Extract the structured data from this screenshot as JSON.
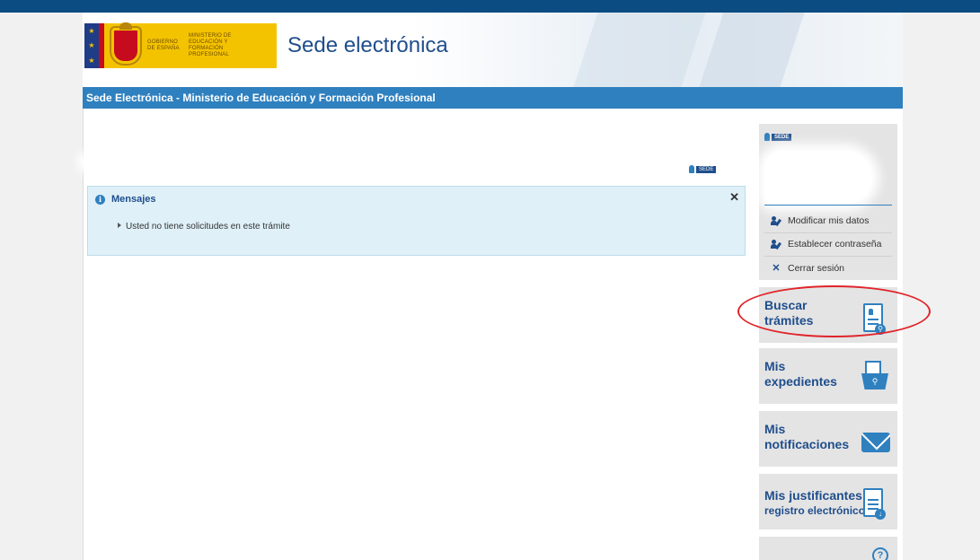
{
  "header": {
    "logo_gov": "GOBIERNO DE ESPAÑA",
    "logo_ministry": "MINISTERIO DE EDUCACIÓN Y FORMACIÓN PROFESIONAL",
    "site_title": "Sede electrónica"
  },
  "navbar": {
    "title": "Sede Electrónica - Ministerio de Educación y Formación Profesional"
  },
  "user_badge_label": "SEDE",
  "messages": {
    "title": "Mensajes",
    "close_symbol": "✕",
    "items": [
      "Usted no tiene solicitudes en este trámite"
    ]
  },
  "sidebar": {
    "user_links": [
      {
        "label": "Modificar mis datos",
        "icon": "user-edit-icon"
      },
      {
        "label": "Establecer contraseña",
        "icon": "user-key-icon"
      },
      {
        "label": "Cerrar sesión",
        "icon": "close-icon"
      }
    ],
    "tiles": [
      {
        "line1": "Buscar",
        "line2": "trámites",
        "icon": "document-search-icon"
      },
      {
        "line1": "Mis",
        "line2": "expedientes",
        "icon": "folder-search-icon"
      },
      {
        "line1": "Mis",
        "line2": "notificaciones",
        "icon": "envelope-icon"
      },
      {
        "line1": "Mis justificantes",
        "line2": "registro electrónico",
        "icon": "document-download-icon"
      }
    ]
  },
  "colors": {
    "topbar": "#0b4c82",
    "navbar": "#2f80bf",
    "brand_text": "#1f4e8c",
    "messages_bg": "#dff0f8",
    "highlight_ellipse": "#e0242a"
  }
}
